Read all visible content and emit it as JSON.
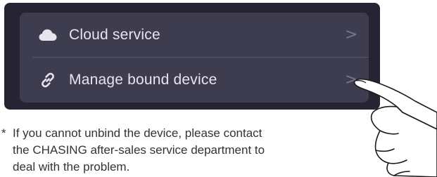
{
  "menu": {
    "items": [
      {
        "label": "Cloud service",
        "icon": "cloud-icon",
        "chevron": ">"
      },
      {
        "label": "Manage bound device",
        "icon": "link-icon",
        "chevron": ">"
      }
    ]
  },
  "note": {
    "marker": "*",
    "lines": [
      "If you cannot unbind the device, please contact",
      "the CHASING after-sales service department to",
      "deal with the problem."
    ]
  },
  "colors": {
    "panel_bg": "#262433",
    "card_bg": "#3e3d50",
    "label_text": "#e6e5ee",
    "chevron": "#76758a",
    "note_text": "#333333"
  },
  "illustration": {
    "icon": "pointing-hand-icon"
  }
}
